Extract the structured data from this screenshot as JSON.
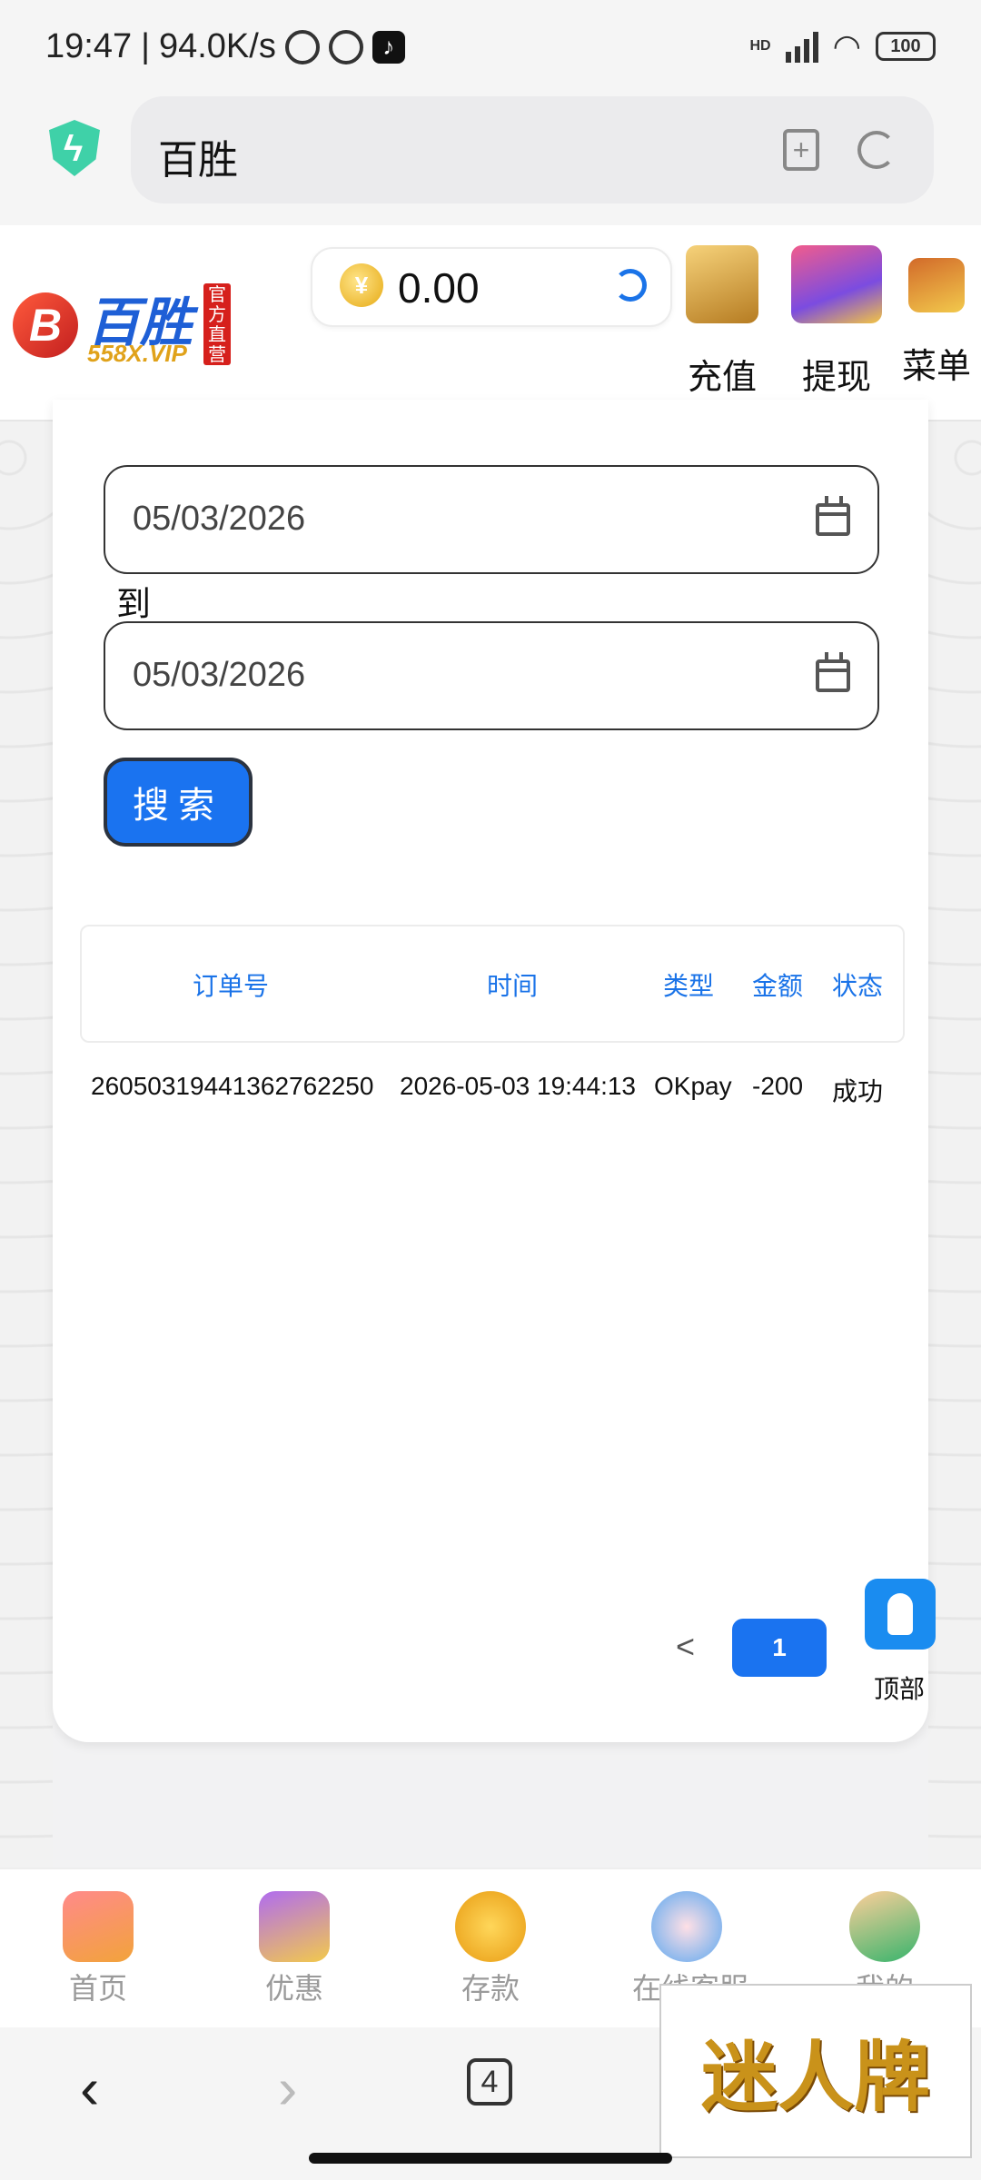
{
  "status_bar": {
    "time": "19:47",
    "speed": "94.0K/s",
    "network": "HD",
    "battery": "100"
  },
  "browser": {
    "url_text": "百胜",
    "tab_count": "4"
  },
  "header": {
    "logo_name": "百胜",
    "logo_sub": "558X.VIP",
    "logo_badge": "官方直营",
    "balance": "0.00",
    "recharge_label": "充值",
    "withdraw_label": "提现",
    "menu_label": "菜单"
  },
  "filter": {
    "date_from": "05/03/2026",
    "to_label": "到",
    "date_to": "05/03/2026",
    "search_label": "搜索"
  },
  "table": {
    "headers": {
      "order": "订单号",
      "time": "时间",
      "type": "类型",
      "amount": "金额",
      "status": "状态"
    },
    "rows": [
      {
        "order": "260503194413627622​50",
        "time": "2026-05-03 19:44:13",
        "type": "OKpay",
        "amount": "-200",
        "status": "成功"
      }
    ]
  },
  "pagination": {
    "prev": "<",
    "current": "1"
  },
  "float_top": {
    "label": "顶部"
  },
  "bottom_nav": {
    "home": "首页",
    "promo": "优惠",
    "deposit": "存款",
    "service": "在线客服",
    "mine": "我的"
  },
  "watermark": "迷人牌"
}
